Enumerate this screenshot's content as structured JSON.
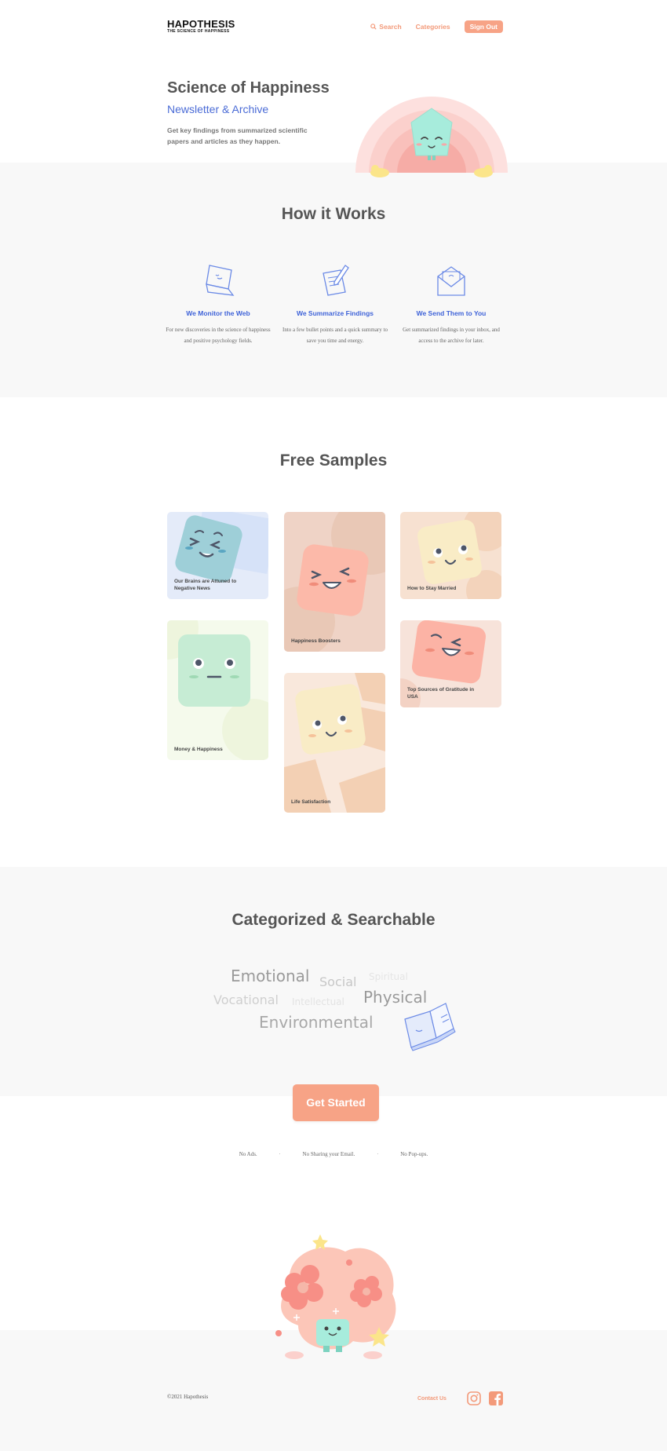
{
  "header": {
    "logo_main": "HAPOTHESIS",
    "logo_sub": "THE SCIENCE OF HAPPINESS",
    "nav": {
      "search": "Search",
      "categories": "Categories",
      "signout": "Sign Out"
    }
  },
  "hero": {
    "title": "Science of Happiness",
    "subtitle": "Newsletter & Archive",
    "description": "Get key findings from summarized scientific papers and articles as they happen."
  },
  "how": {
    "title": "How it Works",
    "steps": [
      {
        "title": "We Monitor the Web",
        "text": "For new discoveries in the science of happiness and positive psychology fields.",
        "icon": "laptop-icon"
      },
      {
        "title": "We Summarize Findings",
        "text": "Into a few bullet points and a quick summary to save you time and energy.",
        "icon": "pen-paper-icon"
      },
      {
        "title": "We Send Them to You",
        "text": "Get summarized findings in your inbox, and access to the archive for later.",
        "icon": "envelope-icon"
      }
    ]
  },
  "samples": {
    "title": "Free Samples",
    "cards": [
      {
        "label": "Our Brains are Attuned to Negative News"
      },
      {
        "label": "Happiness Boosters"
      },
      {
        "label": "How to Stay Married"
      },
      {
        "label": "Money & Happiness"
      },
      {
        "label": "Top Sources of Gratitude in USA"
      },
      {
        "label": "Life Satisfaction"
      }
    ]
  },
  "categories": {
    "title": "Categorized & Searchable",
    "tags": [
      "Emotional",
      "Social",
      "Spiritual",
      "Vocational",
      "Intellectual",
      "Physical",
      "Environmental"
    ]
  },
  "cta": {
    "label": "Get Started"
  },
  "perks": [
    "No Ads.",
    "No Sharing your Email.",
    "No Pop-ups."
  ],
  "perk_separator": "·",
  "footer": {
    "copyright": "©2021 Hapothesis",
    "contact": "Contact Us",
    "social": [
      "instagram-icon",
      "facebook-icon"
    ]
  },
  "colors": {
    "accent": "#f7a386",
    "blue": "#3f63d8",
    "mint": "#9ee8d8",
    "pink": "#fbd0cc"
  }
}
